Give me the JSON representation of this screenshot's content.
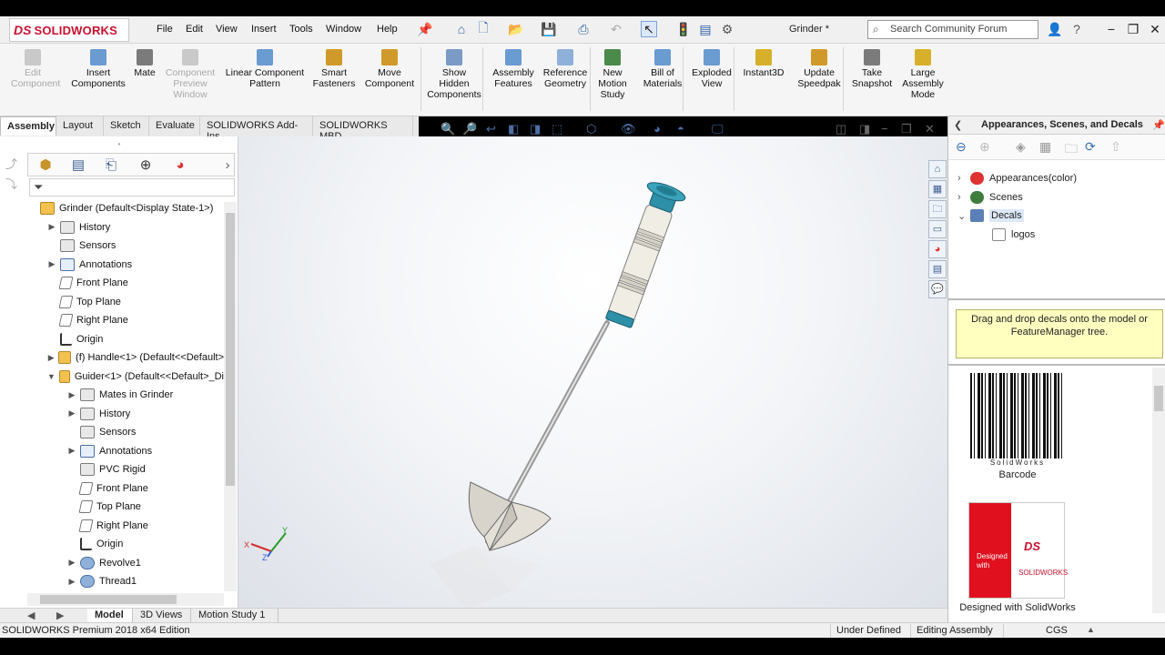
{
  "app": {
    "brand_ds": "DS",
    "brand_name": "SOLIDWORKS",
    "document_title": "Grinder *",
    "search_placeholder": "Search Community Forum"
  },
  "menu": [
    "File",
    "Edit",
    "View",
    "Insert",
    "Tools",
    "Window",
    "Help"
  ],
  "commands": [
    {
      "label": "Edit\nComponent",
      "enabled": false
    },
    {
      "label": "Insert\nComponents",
      "enabled": true
    },
    {
      "label": "Mate",
      "enabled": true
    },
    {
      "label": "Component\nPreview\nWindow",
      "enabled": false
    },
    {
      "label": "Linear Component\nPattern",
      "enabled": true
    },
    {
      "label": "Smart\nFasteners",
      "enabled": true
    },
    {
      "label": "Move\nComponent",
      "enabled": true
    },
    {
      "label": "Show\nHidden\nComponents",
      "enabled": true
    },
    {
      "label": "Assembly\nFeatures",
      "enabled": true
    },
    {
      "label": "Reference\nGeometry",
      "enabled": true
    },
    {
      "label": "New\nMotion\nStudy",
      "enabled": true
    },
    {
      "label": "Bill of\nMaterials",
      "enabled": true
    },
    {
      "label": "Exploded\nView",
      "enabled": true
    },
    {
      "label": "Instant3D",
      "enabled": true
    },
    {
      "label": "Update\nSpeedpak",
      "enabled": true
    },
    {
      "label": "Take\nSnapshot",
      "enabled": true
    },
    {
      "label": "Large\nAssembly\nMode",
      "enabled": true
    }
  ],
  "tabs": [
    "Assembly",
    "Layout",
    "Sketch",
    "Evaluate",
    "SOLIDWORKS Add-Ins",
    "SOLIDWORKS MBD"
  ],
  "active_tab": "Assembly",
  "feature_tree": [
    {
      "text": "Grinder  (Default<Display State-1>)",
      "indent": 0,
      "arrow": "",
      "icon": "asm"
    },
    {
      "text": "History",
      "indent": 1,
      "arrow": "▶",
      "icon": "fold"
    },
    {
      "text": "Sensors",
      "indent": 1,
      "arrow": "",
      "icon": "fold"
    },
    {
      "text": "Annotations",
      "indent": 1,
      "arrow": "▶",
      "icon": "a"
    },
    {
      "text": "Front Plane",
      "indent": 1,
      "arrow": "",
      "icon": "plane"
    },
    {
      "text": "Top Plane",
      "indent": 1,
      "arrow": "",
      "icon": "plane"
    },
    {
      "text": "Right Plane",
      "indent": 1,
      "arrow": "",
      "icon": "plane"
    },
    {
      "text": "Origin",
      "indent": 1,
      "arrow": "",
      "icon": "origin"
    },
    {
      "text": "(f) Handle<1> (Default<<Default>",
      "indent": 1,
      "arrow": "▶",
      "icon": "asm"
    },
    {
      "text": "Guider<1> (Default<<Default>_Di",
      "indent": 1,
      "arrow": "▼",
      "icon": "asm"
    },
    {
      "text": "Mates in Grinder",
      "indent": 2,
      "arrow": "▶",
      "icon": "fold"
    },
    {
      "text": "History",
      "indent": 2,
      "arrow": "▶",
      "icon": "fold"
    },
    {
      "text": "Sensors",
      "indent": 2,
      "arrow": "",
      "icon": "fold"
    },
    {
      "text": "Annotations",
      "indent": 2,
      "arrow": "▶",
      "icon": "a"
    },
    {
      "text": "PVC Rigid",
      "indent": 2,
      "arrow": "",
      "icon": "fold"
    },
    {
      "text": "Front Plane",
      "indent": 2,
      "arrow": "",
      "icon": "plane"
    },
    {
      "text": "Top Plane",
      "indent": 2,
      "arrow": "",
      "icon": "plane"
    },
    {
      "text": "Right Plane",
      "indent": 2,
      "arrow": "",
      "icon": "plane"
    },
    {
      "text": "Origin",
      "indent": 2,
      "arrow": "",
      "icon": "origin"
    },
    {
      "text": "Revolve1",
      "indent": 2,
      "arrow": "▶",
      "icon": "feat"
    },
    {
      "text": "Thread1",
      "indent": 2,
      "arrow": "▶",
      "icon": "feat"
    }
  ],
  "bottom_tabs": [
    "Model",
    "3D Views",
    "Motion Study 1"
  ],
  "active_bottom_tab": "Model",
  "status": {
    "edition": "SOLIDWORKS Premium 2018 x64 Edition",
    "defined": "Under Defined",
    "mode": "Editing Assembly",
    "units": "CGS"
  },
  "task_pane": {
    "title": "Appearances, Scenes, and Decals",
    "tree": [
      {
        "text": "Appearances(color)",
        "arrow": ">",
        "indent": 0
      },
      {
        "text": "Scenes",
        "arrow": ">",
        "indent": 0
      },
      {
        "text": "Decals",
        "arrow": "v",
        "indent": 0
      },
      {
        "text": "logos",
        "arrow": "",
        "indent": 1
      }
    ],
    "hint": "Drag and drop decals onto the model or FeatureManager tree.",
    "decals": [
      {
        "name": "Barcode",
        "barcode_text": "SolidWorks"
      },
      {
        "name": "Designed with SolidWorks",
        "logo_left_text": "Designed with",
        "logo_right_text": "SOLIDWORKS"
      }
    ]
  },
  "triad": {
    "x": "X",
    "y": "Y",
    "z": "Z"
  },
  "colors": {
    "brand_red": "#c8102e",
    "handle_teal": "#2d8fa8",
    "hint_yellow": "#ffffc0"
  }
}
